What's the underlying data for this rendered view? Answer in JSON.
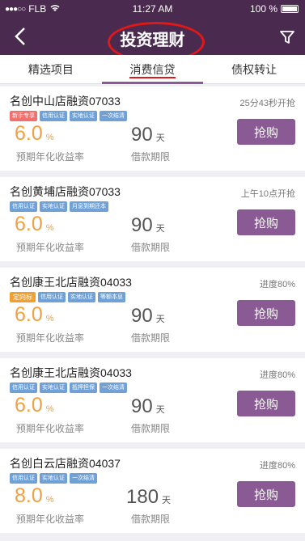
{
  "status_bar": {
    "carrier": "FLB",
    "time": "11:27 AM",
    "battery": "100 %",
    "signal_dots": "●●●○○"
  },
  "nav": {
    "title": "投资理财",
    "back_icon": "chevron-left-icon",
    "filter_icon": "filter-icon"
  },
  "tabs": [
    {
      "label": "精选项目"
    },
    {
      "label": "消费信贷"
    },
    {
      "label": "债权转让"
    }
  ],
  "products": [
    {
      "name": "名创中山店融资07033",
      "status": "25分43秒开抢",
      "badges": [
        "新手专享",
        "信用认证",
        "实地认证",
        "一次结清"
      ],
      "rate": "6.0",
      "rate_unit": "%",
      "rate_label": "预期年化收益率",
      "days": "90",
      "days_unit": "天",
      "days_label": "借款期限",
      "button": "抢购"
    },
    {
      "name": "名创黄埔店融资07033",
      "status": "上午10点开抢",
      "badges": [
        "信用认证",
        "实地认证",
        "月息到期还本"
      ],
      "rate": "6.0",
      "rate_unit": "%",
      "rate_label": "预期年化收益率",
      "days": "90",
      "days_unit": "天",
      "days_label": "借款期限",
      "button": "抢购"
    },
    {
      "name": "名创康王北店融资04033",
      "status": "进度80%",
      "badges": [
        "定向标",
        "信用认证",
        "实地认证",
        "等额本息"
      ],
      "rate": "6.0",
      "rate_unit": "%",
      "rate_label": "预期年化收益率",
      "days": "90",
      "days_unit": "天",
      "days_label": "借款期限",
      "button": "抢购"
    },
    {
      "name": "名创康王北店融资04033",
      "status": "进度80%",
      "badges": [
        "信用认证",
        "实地认证",
        "抵押担保",
        "一次结清"
      ],
      "rate": "6.0",
      "rate_unit": "%",
      "rate_label": "预期年化收益率",
      "days": "90",
      "days_unit": "天",
      "days_label": "借款期限",
      "button": "抢购"
    },
    {
      "name": "名创白云店融资04037",
      "status": "进度80%",
      "badges": [
        "信用认证",
        "实地认证",
        "一次结清"
      ],
      "rate": "8.0",
      "rate_unit": "%",
      "rate_label": "预期年化收益率",
      "days": "180",
      "days_unit": "天",
      "days_label": "借款期限",
      "button": "抢购"
    }
  ],
  "colors": {
    "header": "#4a2a4f",
    "accent": "#8a5a94",
    "rate": "#f0a040",
    "badge": "#6fa0d6",
    "annotation": "#e01818"
  }
}
